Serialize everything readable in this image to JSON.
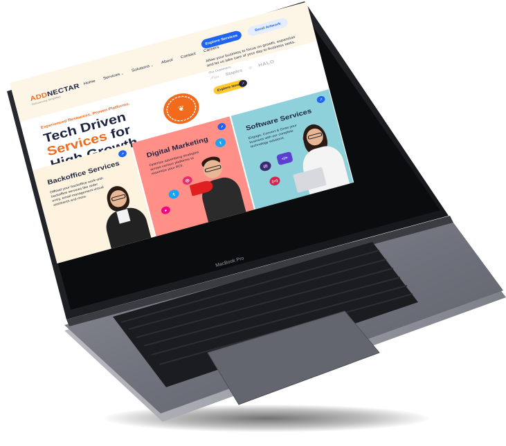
{
  "device": {
    "model_label": "MacBook Pro"
  },
  "site": {
    "logo": {
      "part1": "ADD",
      "part2": "NECTAR",
      "subtitle": "Outsourcing Simplified"
    },
    "nav": [
      {
        "label": "Home",
        "has_caret": false
      },
      {
        "label": "Services",
        "has_caret": true
      },
      {
        "label": "Solutions",
        "has_caret": true
      },
      {
        "label": "About",
        "has_caret": false
      },
      {
        "label": "Contact",
        "has_caret": false
      },
      {
        "label": "Careers",
        "has_caret": false
      }
    ],
    "header_buttons": {
      "primary": "Explore Services",
      "secondary": "Send Artwork"
    },
    "tagline": "Allow your business to focus on growth, expansion and let us take care of your day to business tasks.",
    "customers_label": "Our Customers",
    "customer_logos": [
      "Staples",
      "HALO"
    ],
    "explore_now_label": "Explore Now",
    "hero": {
      "subtitle": "Experienced Resources. Proven Platforms.",
      "title_line1": "Tech Driven",
      "title_highlight": "Services",
      "title_line2_rest": " for",
      "title_line3": "High Growth."
    },
    "cards": [
      {
        "title": "Backoffice Services",
        "body": "Offload your backoffice work with backoffice services like order entry, email management virtual assistants and more."
      },
      {
        "title": "Digital Marketing",
        "body": "Optimize advertising strategies across various platforms to maximize your ROI."
      },
      {
        "title": "Software Services",
        "body": "Engage, Convert & Grow your business with our complete technology solutions."
      }
    ],
    "colors": {
      "brand_orange": "#f26a1b",
      "brand_navy": "#1c2340",
      "primary_blue": "#1e64f0",
      "accent_yellow": "#ffc928",
      "card_cream": "#fdf3df",
      "card_coral": "#ff8f87",
      "card_teal": "#8fd1da"
    },
    "icons": {
      "card_arrow": "arrow-up-right-icon",
      "explore_arrow": "arrow-up-right-icon",
      "social": [
        "twitter-icon",
        "instagram-icon",
        "flickr-icon"
      ],
      "tech": [
        "wordpress-icon",
        "php-icon",
        "code-icon",
        "react-icon"
      ]
    }
  }
}
